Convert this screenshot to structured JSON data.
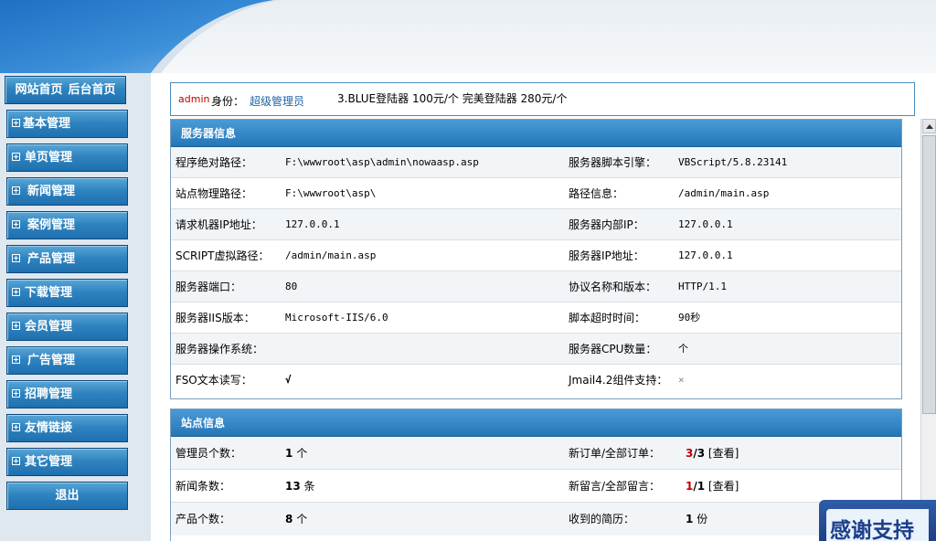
{
  "colors": {
    "accent": "#2f84c0",
    "header_blue": "#2477b8",
    "alert_red": "#c00000"
  },
  "nav": {
    "home_links": [
      "网站首页",
      "后台首页"
    ],
    "items": [
      {
        "label": "基本管理",
        "icon": "plus-box-icon"
      },
      {
        "label": "单页管理",
        "icon": "plus-box-icon"
      },
      {
        "label": "新闻管理",
        "icon": "plus-box-icon"
      },
      {
        "label": "案例管理",
        "icon": "plus-box-icon"
      },
      {
        "label": "产品管理",
        "icon": "plus-box-icon"
      },
      {
        "label": "下载管理",
        "icon": "plus-box-icon"
      },
      {
        "label": "会员管理",
        "icon": "plus-box-icon"
      },
      {
        "label": "广告管理",
        "icon": "plus-box-icon"
      },
      {
        "label": "招聘管理",
        "icon": "plus-box-icon"
      },
      {
        "label": "友情链接",
        "icon": "plus-box-icon"
      },
      {
        "label": "其它管理",
        "icon": "plus-box-icon"
      }
    ],
    "logout": "退出"
  },
  "topbar": {
    "username": "admin",
    "identity_label": "身份：",
    "role": "超级管理员",
    "marquee": "3.BLUE登陆器 100元/个 完美登陆器 280元/个"
  },
  "server_info": {
    "title": "服务器信息",
    "rows": [
      {
        "k1": "程序绝对路径：",
        "v1": "F:\\wwwroot\\asp\\admin\\nowaasp.asp",
        "k2": "服务器脚本引擎：",
        "v2": "VBScript/5.8.23141"
      },
      {
        "k1": "站点物理路径：",
        "v1": "F:\\wwwroot\\asp\\",
        "k2": "路径信息：",
        "v2": "/admin/main.asp"
      },
      {
        "k1": "请求机器IP地址：",
        "v1": "127.0.0.1",
        "k2": "服务器内部IP：",
        "v2": "127.0.0.1"
      },
      {
        "k1": "SCRIPT虚拟路径：",
        "v1": "/admin/main.asp",
        "k2": "服务器IP地址：",
        "v2": "127.0.0.1"
      },
      {
        "k1": "服务器端口：",
        "v1": "80",
        "k2": "协议名称和版本：",
        "v2": "HTTP/1.1"
      },
      {
        "k1": "服务器IIS版本：",
        "v1": "Microsoft-IIS/6.0",
        "k2": "脚本超时时间：",
        "v2": "90秒"
      },
      {
        "k1": "服务器操作系统：",
        "v1": "",
        "k2": "服务器CPU数量：",
        "v2": "个"
      },
      {
        "k1": "FSO文本读写：",
        "v1": "√",
        "k2": "Jmail4.2组件支持：",
        "v2": "×"
      }
    ]
  },
  "site_info": {
    "title": "站点信息",
    "admins_label": "管理员个数：",
    "admins_count": "1",
    "admins_unit": "个",
    "orders_label": "新订单/全部订单：",
    "orders_new": "3",
    "orders_total": "/3",
    "orders_view": "[查看]",
    "news_label": "新闻条数：",
    "news_count": "13",
    "news_unit": "条",
    "messages_label": "新留言/全部留言：",
    "messages_new": "1",
    "messages_total": "/1",
    "messages_view": "[查看]",
    "products_label": "产品个数：",
    "products_count": "8",
    "products_unit": "个",
    "resumes_label": "收到的简历：",
    "resumes_count": "1",
    "resumes_unit": "份"
  },
  "badge": {
    "text": "感谢支持"
  }
}
